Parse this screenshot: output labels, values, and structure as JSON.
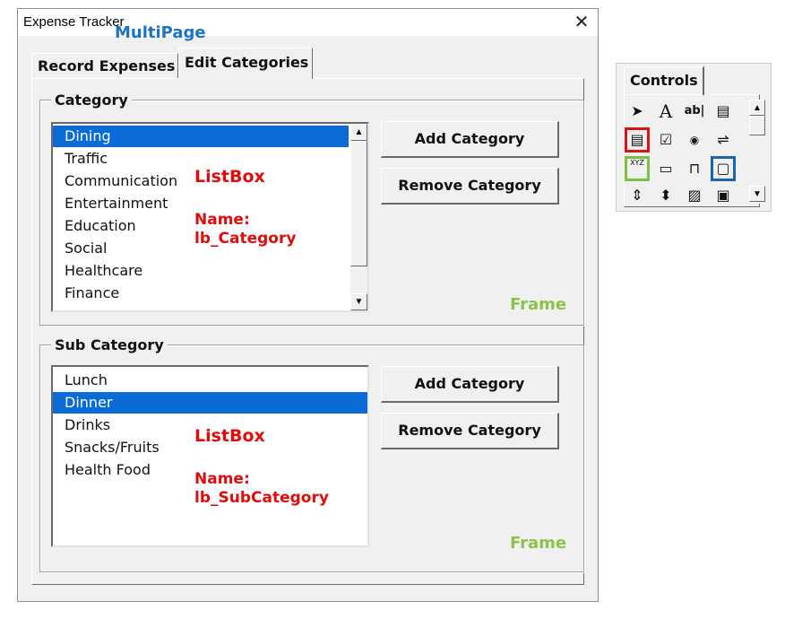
{
  "window": {
    "title": "Expense Tracker",
    "close_glyph": "✕"
  },
  "annotations": {
    "multipage": "MultiPage",
    "listbox_cat": "ListBox",
    "name_cat_label": "Name:",
    "name_cat_value": "lb_Category",
    "listbox_sub": "ListBox",
    "name_sub_label": "Name:",
    "name_sub_value": "lb_SubCategory",
    "frame_cat": "Frame",
    "frame_sub": "Frame"
  },
  "tabs": [
    {
      "label": "Record Expenses",
      "active": false
    },
    {
      "label": "Edit Categories",
      "active": true
    }
  ],
  "category_frame": {
    "title": "Category",
    "items": [
      "Dining",
      "Traffic",
      "Communication",
      "Entertainment",
      "Education",
      "Social",
      "Healthcare",
      "Finance"
    ],
    "selected_index": 0,
    "add_label": "Add Category",
    "remove_label": "Remove Category"
  },
  "subcategory_frame": {
    "title": "Sub Category",
    "items": [
      "Lunch",
      "Dinner",
      "Drinks",
      "Snacks/Fruits",
      "Health Food"
    ],
    "selected_index": 1,
    "add_label": "Add Category",
    "remove_label": "Remove Category"
  },
  "toolbox": {
    "tab_label": "Controls",
    "tools": [
      {
        "icon": "select-pointer-icon",
        "glyph": "➤"
      },
      {
        "icon": "label-icon",
        "glyph": "A"
      },
      {
        "icon": "textbox-icon",
        "glyph": "ab|"
      },
      {
        "icon": "combobox-icon",
        "glyph": "▤"
      },
      {
        "icon": "listbox-icon",
        "glyph": "▤"
      },
      {
        "icon": "checkbox-icon",
        "glyph": "☑"
      },
      {
        "icon": "optionbutton-icon",
        "glyph": "◉"
      },
      {
        "icon": "togglebutton-icon",
        "glyph": "⇌"
      },
      {
        "icon": "frame-icon",
        "glyph": "XYZ"
      },
      {
        "icon": "commandbutton-icon",
        "glyph": "▭"
      },
      {
        "icon": "tabstrip-icon",
        "glyph": "⊓"
      },
      {
        "icon": "multipage-icon",
        "glyph": "▢"
      },
      {
        "icon": "scrollbar-icon",
        "glyph": "⇕"
      },
      {
        "icon": "spinbutton-icon",
        "glyph": "⬍"
      },
      {
        "icon": "image-icon",
        "glyph": "▨"
      },
      {
        "icon": "refedit-icon",
        "glyph": "▣"
      }
    ],
    "highlights": {
      "red": "listbox-icon",
      "green": "frame-icon",
      "blue": "multipage-icon"
    }
  },
  "colors": {
    "selection": "#0a6ad6",
    "annotation_red": "#e00b0b",
    "annotation_green": "#8bc34a",
    "annotation_blue": "#1a73c5"
  }
}
